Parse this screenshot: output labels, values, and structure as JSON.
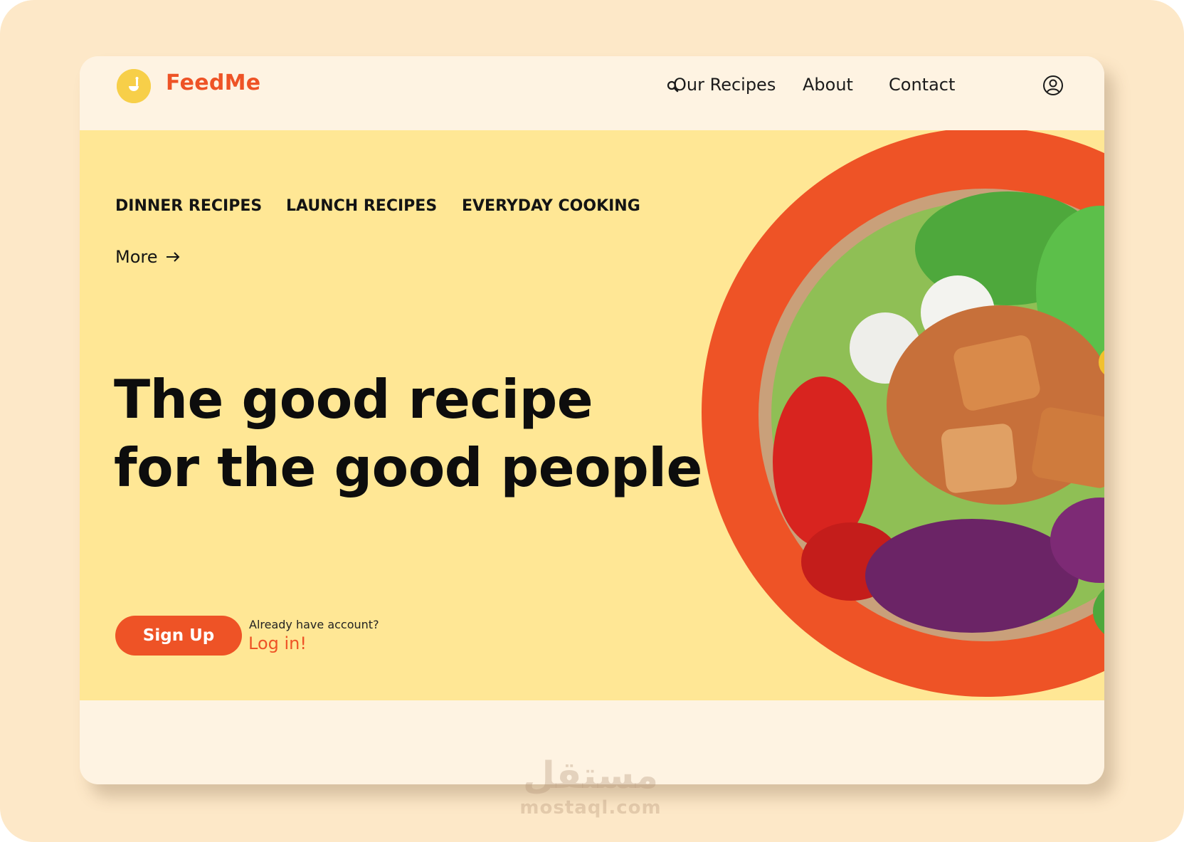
{
  "brand": {
    "name": "FeedMe",
    "color": "#ee5326"
  },
  "nav": {
    "links": [
      "Our Recipes",
      "About",
      "Contact"
    ],
    "search_icon": "search-icon",
    "profile_icon": "user-circle-icon"
  },
  "hero": {
    "categories": [
      "DINNER RECIPES",
      "LAUNCH RECIPES",
      "EVERYDAY COOKING"
    ],
    "more_label": "More",
    "headline": [
      "The good recipe",
      "for the good people"
    ],
    "signup_label": "Sign Up",
    "already_text": "Already have account?",
    "login_label": "Log in!",
    "background_color": "#ffe795",
    "accent_color": "#ee5326"
  },
  "watermark": {
    "arabic": "مستقل",
    "latin": "mostaql.com"
  }
}
